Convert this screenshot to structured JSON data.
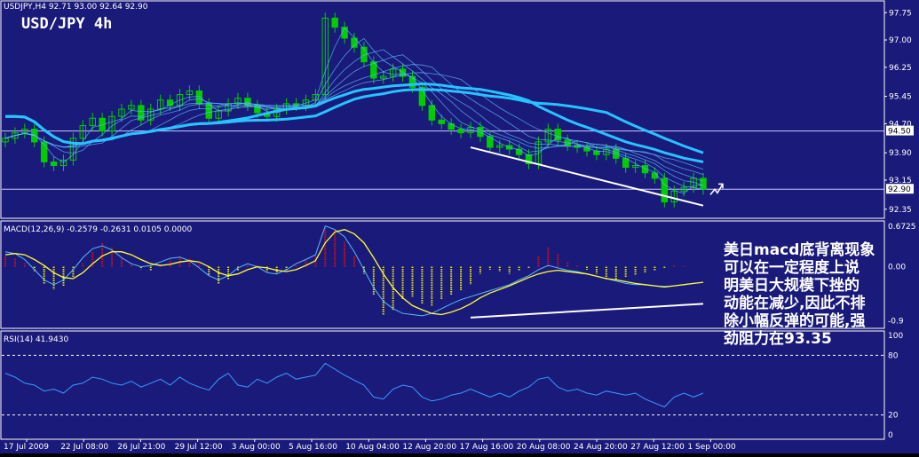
{
  "colors": {
    "background": "#1a1a7a",
    "frame": "#ffffff",
    "candle_up": "#00cc00",
    "candle_down": "#00cc00",
    "ribbon": "#5ab8ff",
    "slow_ma": "#27c3ff",
    "macd_pos": "#d01010",
    "macd_neg": "#e0e010",
    "macd_line": "#5ab8ff",
    "macd_signal": "#ffff33",
    "rsi_line": "#3a9aff",
    "trendline": "#ffffff",
    "arrow": "#ffffff"
  },
  "main": {
    "header": "USDJPY,H4  92.71 93.00 92.64 92.90",
    "title": "USD/JPY 4h"
  },
  "macd": {
    "header": "MACD(12,26,9) -0.2579 -0.2631 0.0105 0.0000"
  },
  "rsi": {
    "header": "RSI(14) 41.9430"
  },
  "annotation": {
    "lines": [
      "美日macd底背离现象",
      "可以在一定程度上说",
      "明美日大规模下挫的",
      "动能在减少,因此不排",
      "除小幅反弹的可能,强",
      "劲阻力在93.35"
    ]
  },
  "chart_data": [
    {
      "type": "candlestick",
      "title": "USD/JPY 4h",
      "ylim": [
        92.15,
        98.0
      ],
      "yticks": [
        "97.75",
        "97.00",
        "96.25",
        "95.45",
        "94.70",
        "94.50",
        "93.90",
        "93.15",
        "92.90",
        "92.35"
      ],
      "highlighted_levels": [
        94.5,
        92.9
      ],
      "x": [
        "17 Jul 2009",
        "22 Jul 08:00",
        "26 Jul 21:00",
        "29 Jul 12:00",
        "3 Aug 00:00",
        "5 Aug 16:00",
        "10 Aug 04:00",
        "12 Aug 20:00",
        "17 Aug 16:00",
        "20 Aug 08:00",
        "24 Aug 20:00",
        "27 Aug 12:00",
        "1 Sep 00:00"
      ],
      "close": [
        94.3,
        94.45,
        94.55,
        94.2,
        93.65,
        93.55,
        93.7,
        94.3,
        94.65,
        94.85,
        94.5,
        94.9,
        95.1,
        95.2,
        94.8,
        95.1,
        95.35,
        95.2,
        95.5,
        95.6,
        95.25,
        94.85,
        95.05,
        95.25,
        95.4,
        95.2,
        95.0,
        94.9,
        95.1,
        95.25,
        95.2,
        95.35,
        95.5,
        97.6,
        97.35,
        97.05,
        96.8,
        96.4,
        95.95,
        96.0,
        96.2,
        96.0,
        95.7,
        95.2,
        94.8,
        94.7,
        94.55,
        94.45,
        94.6,
        94.35,
        94.05,
        94.1,
        94.0,
        93.85,
        93.6,
        94.2,
        94.55,
        94.25,
        94.1,
        94.05,
        93.95,
        93.85,
        94.0,
        93.75,
        93.5,
        93.55,
        93.35,
        93.2,
        92.55,
        92.85,
        92.95,
        93.2,
        92.9
      ],
      "trendline": {
        "from": [
          94.05,
          "17 Aug 16:00"
        ],
        "to": [
          92.45,
          "1 Sep 00:00"
        ]
      },
      "moving_averages": [
        "ribbon",
        "slow"
      ]
    },
    {
      "type": "bar",
      "title": "MACD(12,26,9) -0.2579 -0.2631 0.0105 0.0000",
      "ylim": [
        -1.0,
        0.72
      ],
      "yticks": [
        "0.6725",
        "0.00",
        "-0.9"
      ],
      "histogram": [
        0.18,
        0.14,
        0.05,
        -0.08,
        -0.28,
        -0.38,
        -0.32,
        -0.18,
        0.05,
        0.25,
        0.4,
        0.32,
        0.15,
        0.05,
        -0.04,
        -0.06,
        0.04,
        0.12,
        0.18,
        0.15,
        0.05,
        -0.15,
        -0.28,
        -0.22,
        -0.06,
        0.04,
        0.02,
        -0.08,
        -0.12,
        -0.06,
        0.02,
        0.1,
        0.18,
        0.65,
        0.62,
        0.42,
        0.18,
        -0.12,
        -0.48,
        -0.8,
        -0.72,
        -0.55,
        -0.5,
        -0.62,
        -0.65,
        -0.55,
        -0.48,
        -0.4,
        -0.3,
        -0.12,
        -0.05,
        -0.08,
        -0.12,
        -0.06,
        -0.02,
        0.18,
        0.32,
        0.22,
        0.08,
        0.02,
        -0.05,
        -0.12,
        -0.2,
        -0.22,
        -0.18,
        -0.14,
        -0.1,
        -0.06,
        -0.02,
        0.02,
        0.01,
        0.0,
        0.0
      ],
      "macd_line": [
        0.25,
        0.22,
        0.12,
        -0.05,
        -0.22,
        -0.3,
        -0.22,
        -0.05,
        0.15,
        0.3,
        0.35,
        0.28,
        0.15,
        0.05,
        0.0,
        0.02,
        0.08,
        0.14,
        0.16,
        0.1,
        -0.02,
        -0.15,
        -0.22,
        -0.15,
        -0.02,
        0.05,
        0.0,
        -0.1,
        -0.12,
        -0.05,
        0.05,
        0.12,
        0.2,
        0.68,
        0.62,
        0.5,
        0.25,
        -0.05,
        -0.35,
        -0.58,
        -0.7,
        -0.78,
        -0.8,
        -0.82,
        -0.78,
        -0.7,
        -0.62,
        -0.55,
        -0.5,
        -0.45,
        -0.4,
        -0.35,
        -0.3,
        -0.22,
        -0.15,
        -0.05,
        0.02,
        -0.02,
        -0.06,
        -0.08,
        -0.12,
        -0.16,
        -0.2,
        -0.24,
        -0.28,
        -0.3,
        -0.3,
        -0.32,
        -0.33,
        -0.32,
        -0.3,
        -0.28,
        -0.26
      ],
      "signal_line": [
        0.2,
        0.22,
        0.2,
        0.12,
        0.02,
        -0.1,
        -0.18,
        -0.2,
        -0.1,
        0.05,
        0.18,
        0.25,
        0.25,
        0.2,
        0.12,
        0.05,
        0.02,
        0.04,
        0.08,
        0.1,
        0.08,
        0.0,
        -0.1,
        -0.15,
        -0.12,
        -0.05,
        0.0,
        -0.02,
        -0.06,
        -0.08,
        -0.05,
        0.02,
        0.1,
        0.4,
        0.58,
        0.62,
        0.55,
        0.4,
        0.15,
        -0.12,
        -0.35,
        -0.52,
        -0.65,
        -0.72,
        -0.78,
        -0.8,
        -0.76,
        -0.7,
        -0.62,
        -0.52,
        -0.44,
        -0.38,
        -0.32,
        -0.25,
        -0.18,
        -0.12,
        -0.08,
        -0.06,
        -0.08,
        -0.1,
        -0.12,
        -0.16,
        -0.2,
        -0.22,
        -0.25,
        -0.28,
        -0.3,
        -0.32,
        -0.34,
        -0.32,
        -0.3,
        -0.28,
        -0.26
      ],
      "trendline": {
        "from": [
          -0.85,
          "17 Aug 16:00"
        ],
        "to": [
          -0.62,
          "1 Sep 00:00"
        ]
      }
    },
    {
      "type": "line",
      "title": "RSI(14) 41.9430",
      "ylim": [
        0,
        100
      ],
      "yticks": [
        "100",
        "80",
        "20",
        "0"
      ],
      "levels": [
        80,
        20
      ],
      "values": [
        62,
        58,
        52,
        50,
        44,
        46,
        42,
        50,
        52,
        58,
        56,
        52,
        50,
        54,
        48,
        52,
        56,
        50,
        58,
        52,
        48,
        45,
        56,
        62,
        50,
        48,
        56,
        52,
        58,
        62,
        56,
        58,
        60,
        72,
        66,
        60,
        55,
        50,
        38,
        36,
        46,
        50,
        48,
        38,
        34,
        36,
        40,
        42,
        46,
        42,
        38,
        42,
        38,
        44,
        48,
        56,
        58,
        48,
        44,
        46,
        42,
        40,
        44,
        42,
        40,
        42,
        36,
        32,
        28,
        38,
        42,
        38,
        42
      ]
    }
  ]
}
